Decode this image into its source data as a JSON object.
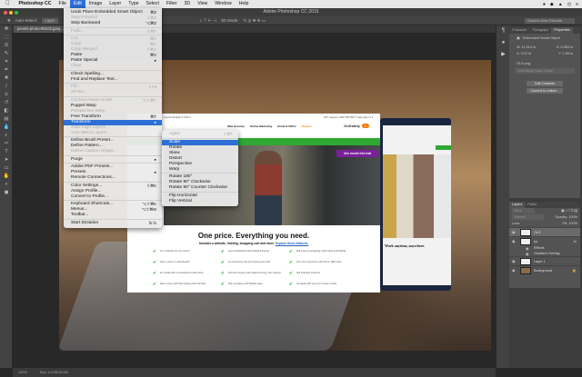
{
  "menubar": {
    "apple_icon": "apple-icon",
    "app_name": "Photoshop CC",
    "items": [
      "File",
      "Edit",
      "Image",
      "Layer",
      "Type",
      "Select",
      "Filter",
      "3D",
      "View",
      "Window",
      "Help"
    ],
    "active": "Edit"
  },
  "window": {
    "title": "Adobe Photoshop CC 2015"
  },
  "options_bar": {
    "auto_select": "Auto-Select:",
    "auto_select_target": "Layer",
    "mode_3d": "3D Mode:",
    "workspace": "Sarah's New Favorite"
  },
  "document_tab": {
    "name": "pexels-photo-89432.jpeg..."
  },
  "edit_menu": [
    {
      "label": "Undo Place Embedded Smart Object",
      "shortcut": "⌘Z"
    },
    {
      "label": "Step Forward",
      "shortcut": "⇧⌘Z",
      "disabled": true
    },
    {
      "label": "Step Backward",
      "shortcut": "⌥⌘Z"
    },
    {
      "sep": true
    },
    {
      "label": "Fade...",
      "shortcut": "⇧⌘F",
      "disabled": true
    },
    {
      "sep": true
    },
    {
      "label": "Cut",
      "shortcut": "⌘X",
      "disabled": true
    },
    {
      "label": "Copy",
      "shortcut": "⌘C",
      "disabled": true
    },
    {
      "label": "Copy Merged",
      "shortcut": "⇧⌘C",
      "disabled": true
    },
    {
      "label": "Paste",
      "shortcut": "⌘V"
    },
    {
      "label": "Paste Special",
      "shortcut": "▸"
    },
    {
      "label": "Clear",
      "disabled": true
    },
    {
      "sep": true
    },
    {
      "label": "Check Spelling..."
    },
    {
      "label": "Find and Replace Text..."
    },
    {
      "sep": true
    },
    {
      "label": "Fill...",
      "shortcut": "⇧F5",
      "disabled": true
    },
    {
      "label": "Stroke...",
      "disabled": true
    },
    {
      "sep": true
    },
    {
      "label": "Content-Aware Scale",
      "shortcut": "⌥⇧⌘C",
      "disabled": true
    },
    {
      "label": "Puppet Warp"
    },
    {
      "label": "Perspective Warp",
      "disabled": true
    },
    {
      "label": "Free Transform",
      "shortcut": "⌘T"
    },
    {
      "label": "Transform",
      "shortcut": "▸",
      "highlighted": true
    },
    {
      "label": "Auto-Align Layers...",
      "disabled": true
    },
    {
      "label": "Auto-Blend Layers...",
      "disabled": true
    },
    {
      "sep": true
    },
    {
      "label": "Define Brush Preset..."
    },
    {
      "label": "Define Pattern..."
    },
    {
      "label": "Define Custom Shape...",
      "disabled": true
    },
    {
      "sep": true
    },
    {
      "label": "Purge",
      "shortcut": "▸"
    },
    {
      "sep": true
    },
    {
      "label": "Adobe PDF Presets..."
    },
    {
      "label": "Presets",
      "shortcut": "▸"
    },
    {
      "label": "Remote Connections..."
    },
    {
      "sep": true
    },
    {
      "label": "Color Settings...",
      "shortcut": "⇧⌘K"
    },
    {
      "label": "Assign Profile..."
    },
    {
      "label": "Convert to Profile..."
    },
    {
      "sep": true
    },
    {
      "label": "Keyboard Shortcuts...",
      "shortcut": "⌥⇧⌘K"
    },
    {
      "label": "Menus...",
      "shortcut": "⌥⇧⌘M"
    },
    {
      "label": "Toolbar..."
    },
    {
      "sep": true
    },
    {
      "label": "Start Dictation",
      "shortcut": "fn fn"
    }
  ],
  "transform_submenu": [
    {
      "label": "Again",
      "shortcut": "⇧⌘T",
      "disabled": true
    },
    {
      "sep": true
    },
    {
      "label": "Scale",
      "highlighted": true
    },
    {
      "label": "Rotate"
    },
    {
      "label": "Skew"
    },
    {
      "label": "Distort"
    },
    {
      "label": "Perspective"
    },
    {
      "label": "Warp"
    },
    {
      "sep": true
    },
    {
      "label": "Rotate 180°"
    },
    {
      "label": "Rotate 90° Clockwise"
    },
    {
      "label": "Rotate 90° Counter Clockwise"
    },
    {
      "sep": true
    },
    {
      "label": "Flip Horizontal"
    },
    {
      "label": "Flip Vertical"
    }
  ],
  "website": {
    "top_left": "Search  English ▾   USD ▾",
    "top_right": "24/7 Support (480) 505-8877    Help    Sign In ▾",
    "nav": [
      "Web Security",
      "Online Marketing",
      "Email & Office",
      "Promos"
    ],
    "logo": "GoDaddy",
    "badge": "One month free trial",
    "headline": "One price. Everything you need.",
    "subline": "Includes a website, hosting, shopping cart and more.",
    "subline_link": "Explore these features.",
    "features": [
      "Try it risk-free for one month",
      "Look professional with beautiful themes",
      "Sell more by accepting credit cards and PayPal",
      "Open a store on Facebook®",
      "Let customers rate and review your stuff",
      "Get more customers with built-in SEO tools",
      "Go mobile with a smartphone-ready store",
      "Get help anytime with award-winning, 24/7 support",
      "Sell unlimited products",
      "Save money with free hosting and unlimited",
      "Ship anywhere with flexible rates",
      "Cut deals with your own coupon codes"
    ],
    "laptop_headline": "Work anytime, anywhere."
  },
  "properties_panel": {
    "tabs": [
      "Character",
      "Paragraph",
      "Properties"
    ],
    "active_tab": "Properties",
    "type": "Embedded Smart Object",
    "w": "W: 11.514 in",
    "h": "H: 6.583 in",
    "x": "X: 3.12 in",
    "y": "Y: 1.69 in",
    "file": "OLS.png",
    "layer_comp": "Don't Apply Layer Comp",
    "edit_contents": "Edit Contents",
    "convert_linked": "Convert to Linked..."
  },
  "layers_panel": {
    "tabs": [
      "Layers",
      "Paths"
    ],
    "kind": "Kind",
    "blend_mode": "Normal",
    "opacity": "Opacity: 100%",
    "lock": "Lock:",
    "fill": "Fill: 100%",
    "layers": [
      {
        "name": "OLS",
        "selected": true
      },
      {
        "name": "hp",
        "fx": true
      },
      {
        "name": "Effects",
        "sub": true
      },
      {
        "name": "Gradient Overlay",
        "sub": true
      },
      {
        "name": "Layer 1"
      },
      {
        "name": "Background",
        "locked": true
      }
    ]
  },
  "status_bar": {
    "zoom": "100%",
    "doc": "Doc: 4.47M/15.0M"
  }
}
